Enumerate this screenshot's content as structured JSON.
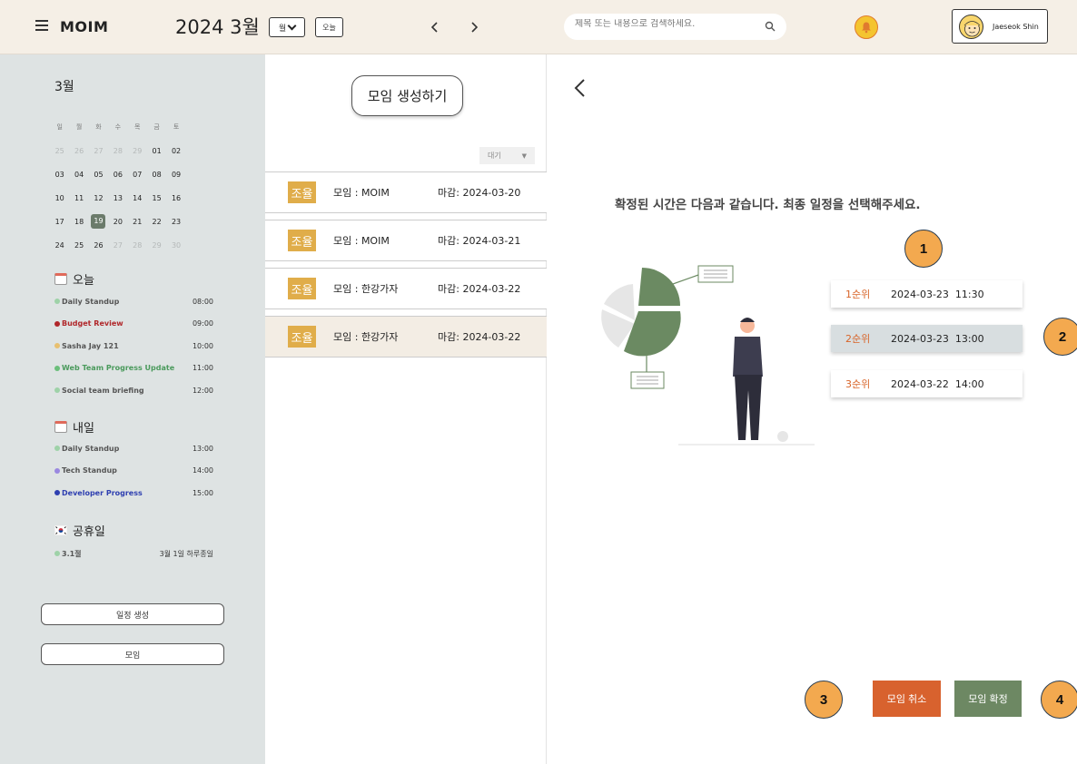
{
  "header": {
    "app_title": "MOIM",
    "date_title": "2024 3월",
    "view_select": "월",
    "today_label": "오늘",
    "prev_label": "‹",
    "next_label": "›",
    "search_placeholder": "제목 또는 내용으로 검색하세요.",
    "user_name": "Jaeseok Shin"
  },
  "calendar": {
    "month_label": "3월",
    "weekdays": [
      "일",
      "월",
      "화",
      "수",
      "목",
      "금",
      "토"
    ],
    "weeks": [
      [
        "25",
        "26",
        "27",
        "28",
        "29",
        "01",
        "02"
      ],
      [
        "03",
        "04",
        "05",
        "06",
        "07",
        "08",
        "09"
      ],
      [
        "10",
        "11",
        "12",
        "13",
        "14",
        "15",
        "16"
      ],
      [
        "17",
        "18",
        "19",
        "20",
        "21",
        "22",
        "23"
      ],
      [
        "24",
        "25",
        "26",
        "27",
        "28",
        "29",
        "30"
      ]
    ],
    "selected": "19"
  },
  "today": {
    "label": "오늘",
    "events": [
      {
        "name": "Daily Standup",
        "time": "08:00",
        "color": "#9ed2a8",
        "text_color": "#555555"
      },
      {
        "name": "Budget Review",
        "time": "09:00",
        "color": "#b0272a",
        "text_color": "#b0272a"
      },
      {
        "name": "Sasha Jay 121",
        "time": "10:00",
        "color": "#e8c070",
        "text_color": "#555555"
      },
      {
        "name": "Web Team Progress Update",
        "time": "11:00",
        "color": "#6bbf7b",
        "text_color": "#4a9a5c"
      },
      {
        "name": "Social team briefing",
        "time": "12:00",
        "color": "#9ed2a8",
        "text_color": "#555555"
      }
    ]
  },
  "tomorrow": {
    "label": "내일",
    "events": [
      {
        "name": "Daily Standup",
        "time": "13:00",
        "color": "#9ed2a8",
        "text_color": "#555555"
      },
      {
        "name": "Tech Standup",
        "time": "14:00",
        "color": "#9a88e0",
        "text_color": "#555555"
      },
      {
        "name": "Developer Progress",
        "time": "15:00",
        "color": "#2e3fb0",
        "text_color": "#2e3fb0"
      }
    ]
  },
  "holidays": {
    "label": "공휴일",
    "events": [
      {
        "name": "3.1절",
        "time": "3월 1일 하루종일",
        "color": "#9ed2a8",
        "text_color": "#555555"
      }
    ]
  },
  "sidebar_buttons": {
    "create_schedule": "일정 생성",
    "meeting": "모임"
  },
  "middle": {
    "create_button": "모임 생성하기",
    "filter_label": "대기",
    "meetings": [
      {
        "badge": "조율",
        "name": "모임 : MOIM",
        "deadline": "마감: 2024-03-20"
      },
      {
        "badge": "조율",
        "name": "모임 : MOIM",
        "deadline": "마감: 2024-03-21"
      },
      {
        "badge": "조율",
        "name": "모임 : 한강가자",
        "deadline": "마감: 2024-03-22"
      },
      {
        "badge": "조율",
        "name": "모임 : 한강가자",
        "deadline": "마감: 2024-03-22"
      }
    ],
    "active_index": 3
  },
  "detail": {
    "message": "확정된 시간은 다음과 같습니다. 최종 일정을 선택해주세요.",
    "slots": [
      {
        "rank": "1순위",
        "time": "2024-03-23  11:30"
      },
      {
        "rank": "2순위",
        "time": "2024-03-23  13:00"
      },
      {
        "rank": "3순위",
        "time": "2024-03-22  14:00"
      }
    ],
    "selected_slot": 1,
    "cancel_label": "모임 취소",
    "confirm_label": "모임 확정",
    "markers": [
      "1",
      "2",
      "3",
      "4"
    ]
  },
  "colors": {
    "accent_orange": "#d8622e",
    "accent_green": "#6d8863",
    "badge": "#e0ad4a",
    "sidebar_bg": "#dee3e3",
    "topbar_bg": "#f5efe6"
  }
}
